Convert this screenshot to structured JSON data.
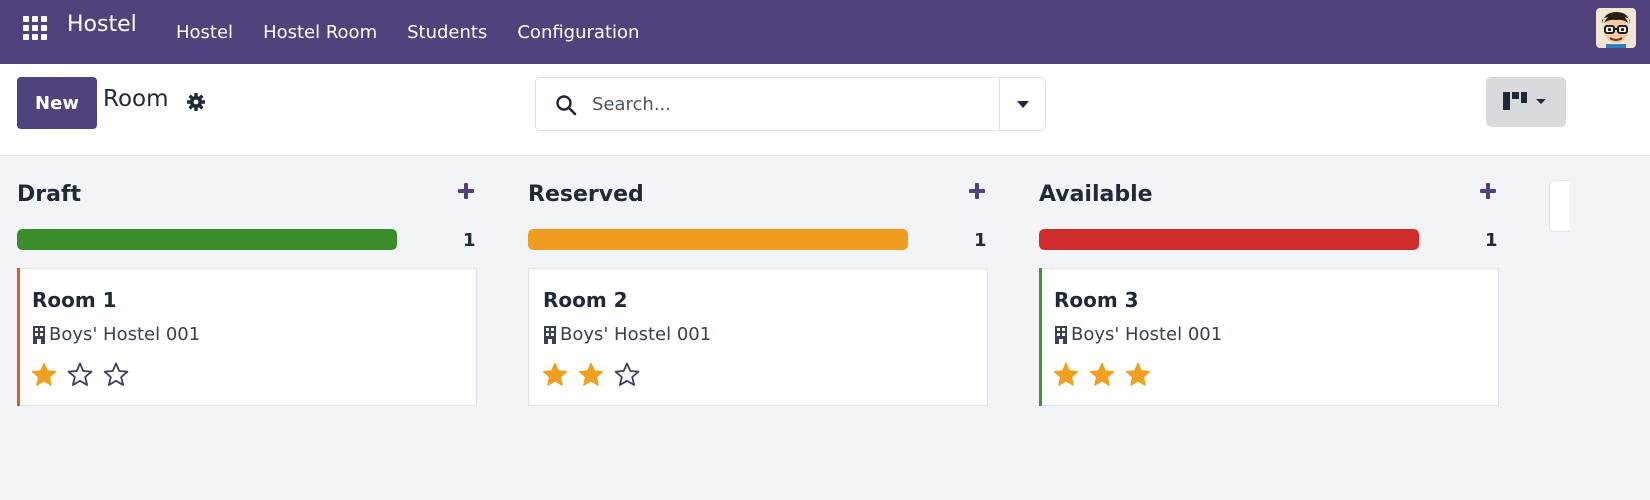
{
  "navbar": {
    "brand": "Hostel",
    "menu": [
      "Hostel",
      "Hostel Room",
      "Students",
      "Configuration"
    ]
  },
  "control": {
    "new_label": "New",
    "title": "Room",
    "search_placeholder": "Search..."
  },
  "columns": [
    {
      "title": "Draft",
      "count": "1",
      "progress_color": "#3b8d2b",
      "progress": 1.0,
      "card": {
        "title": "Room 1",
        "hostel": "Boys' Hostel 001",
        "rating": 1,
        "max_rating": 3,
        "accent": "#e25b17"
      }
    },
    {
      "title": "Reserved",
      "count": "1",
      "progress_color": "#ef9c20",
      "progress": 1.0,
      "card": {
        "title": "Room 2",
        "hostel": "Boys' Hostel 001",
        "rating": 2,
        "max_rating": 3,
        "accent": ""
      }
    },
    {
      "title": "Available",
      "count": "1",
      "progress_color": "#d12c2c",
      "progress": 1.0,
      "card": {
        "title": "Room 3",
        "hostel": "Boys' Hostel 001",
        "rating": 3,
        "max_rating": 3,
        "accent": "#3b9a2d"
      }
    }
  ],
  "colors": {
    "primary": "#51427d",
    "star": "#f0a020"
  }
}
